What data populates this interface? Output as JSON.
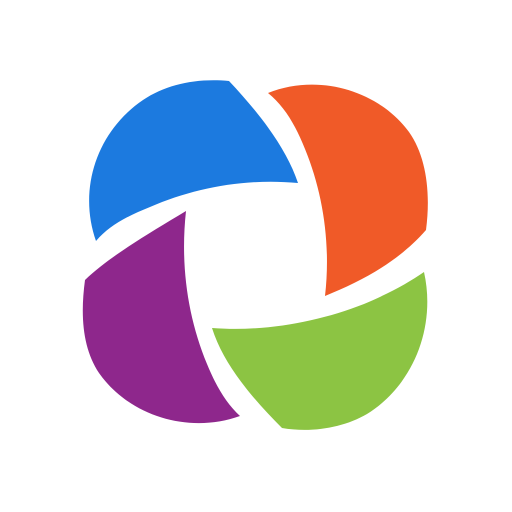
{
  "logo": {
    "icon": "four-petal-swirl-logo",
    "colors": {
      "background": "#ffffff",
      "blue": "#1C7ADF",
      "orange": "#F05A28",
      "purple": "#8E278C",
      "green": "#8CC443"
    }
  }
}
